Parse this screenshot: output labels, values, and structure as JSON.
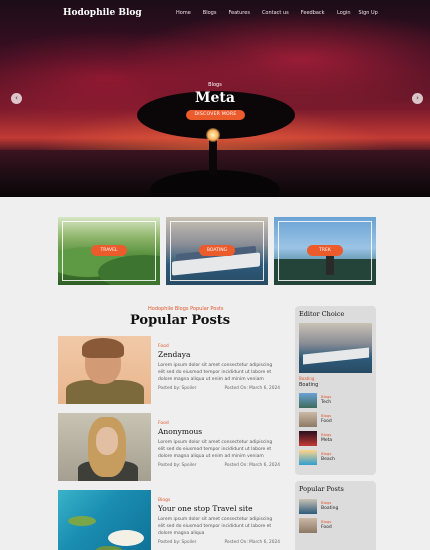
{
  "header": {
    "logo": "Hodophile Blog",
    "nav": [
      "Home",
      "Blogs",
      "Features",
      "Contact us",
      "Feedback"
    ],
    "auth": [
      "Login",
      "Sign Up"
    ]
  },
  "hero": {
    "category": "Blogs",
    "title": "Meta",
    "button": "DISCOVER MORE",
    "prev_icon": "chevron-left-icon",
    "next_icon": "chevron-right-icon"
  },
  "categories": [
    {
      "label": "TRAVEL"
    },
    {
      "label": "BOATING"
    },
    {
      "label": "TREK"
    }
  ],
  "popular": {
    "kicker": "Hodophile Blogs Popular Posts",
    "title": "Popular Posts",
    "posts": [
      {
        "category": "Food",
        "title": "Zendaya",
        "excerpt": "Lorem ipsum dolor sit amet consectetur adipiscing elit sed do eiusmod tempor incididunt ut labore et dolore magna aliqua ut enim ad minim veniam",
        "author": "Posted by: Spoiler",
        "date": "Posted On: March 6, 2024"
      },
      {
        "category": "Food",
        "title": "Anonymous",
        "excerpt": "Lorem ipsum dolor sit amet consectetur adipiscing elit sed do eiusmod tempor incididunt ut labore et dolore magna aliqua ut enim ad minim veniam",
        "author": "Posted by: Spoiler",
        "date": "Posted On: March 6, 2024"
      },
      {
        "category": "Blogs",
        "title": "Your one stop Travel site",
        "excerpt": "Lorem ipsum dolor sit amet consectetur adipiscing elit sed do eiusmod tempor incididunt ut labore et dolore magna aliqua",
        "author": "Posted by: Spoiler",
        "date": "Posted On: March 6, 2024"
      }
    ]
  },
  "editor_choice": {
    "title": "Editor Choice",
    "featured_category": "Boating",
    "featured_title": "Boating",
    "items": [
      {
        "category": "Blogs",
        "title": "Tech"
      },
      {
        "category": "Blogs",
        "title": "Food"
      },
      {
        "category": "Blogs",
        "title": "Meta"
      },
      {
        "category": "Blogs",
        "title": "Beach"
      }
    ]
  },
  "popular_sidebar": {
    "title": "Popular Posts",
    "items": [
      {
        "category": "Blogs",
        "title": "Boating"
      },
      {
        "category": "Blogs",
        "title": "Food"
      }
    ]
  },
  "colors": {
    "accent": "#ec5b2c",
    "panel": "#dcdcdc"
  }
}
